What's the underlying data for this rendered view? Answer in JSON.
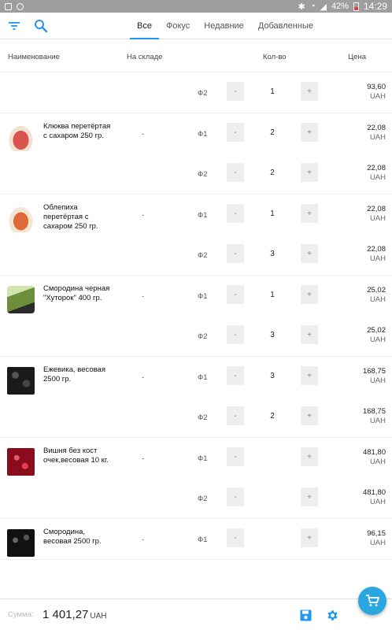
{
  "statusbar": {
    "battery": "42%",
    "time": "14:29"
  },
  "tabs": [
    {
      "label": "Все",
      "active": true
    },
    {
      "label": "Фокус",
      "active": false
    },
    {
      "label": "Недавние",
      "active": false
    },
    {
      "label": "Добавленные",
      "active": false
    }
  ],
  "columns": {
    "name": "Наименование",
    "stock": "На складе",
    "qty": "Кол-во",
    "price": "Цена"
  },
  "qty_minus": "-",
  "qty_plus": "+",
  "currency": "UAH",
  "items": [
    {
      "name": "",
      "stock": "",
      "thumb": "",
      "lines": [
        {
          "code": "Ф2",
          "qty": "1",
          "price": "93,60"
        }
      ]
    },
    {
      "name": "Клюква перетёртая с сахаром 250 гр.",
      "stock": "-",
      "thumb": "jar",
      "lines": [
        {
          "code": "Ф1",
          "qty": "2",
          "price": "22,08"
        },
        {
          "code": "Ф2",
          "qty": "2",
          "price": "22,08"
        }
      ]
    },
    {
      "name": "Облепиха перетёртая с сахаром 250 гр.",
      "stock": "-",
      "thumb": "jar2",
      "lines": [
        {
          "code": "Ф1",
          "qty": "1",
          "price": "22,08"
        },
        {
          "code": "Ф2",
          "qty": "3",
          "price": "22,08"
        }
      ]
    },
    {
      "name": "Смородина черная \"Хуторок\" 400 гр.",
      "stock": "-",
      "thumb": "pack",
      "lines": [
        {
          "code": "Ф1",
          "qty": "1",
          "price": "25,02"
        },
        {
          "code": "Ф2",
          "qty": "3",
          "price": "25,02"
        }
      ]
    },
    {
      "name": "Ежевика, весовая 2500 гр.",
      "stock": "-",
      "thumb": "black",
      "lines": [
        {
          "code": "Ф1",
          "qty": "3",
          "price": "168,75"
        },
        {
          "code": "Ф2",
          "qty": "2",
          "price": "168,75"
        }
      ]
    },
    {
      "name": "Вишня без кост очек,весовая 10 кг.",
      "stock": "-",
      "thumb": "cherry",
      "lines": [
        {
          "code": "Ф1",
          "qty": "",
          "price": "481,80"
        },
        {
          "code": "Ф2",
          "qty": "",
          "price": "481,80"
        }
      ]
    },
    {
      "name": "Смородина, весовая 2500 гр.",
      "stock": "-",
      "thumb": "currant",
      "lines": [
        {
          "code": "Ф1",
          "qty": "",
          "price": "96,15"
        }
      ]
    }
  ],
  "footer": {
    "sum_label": "Сумма:",
    "sum_value": "1 401,27",
    "sum_currency": "UAH"
  },
  "icons": {
    "filter": "filter-icon",
    "search": "search-icon",
    "save": "save-icon",
    "settings": "gear-icon",
    "cart": "cart-icon"
  },
  "colors": {
    "accent": "#2196f3",
    "fab": "#2aa7e0"
  }
}
